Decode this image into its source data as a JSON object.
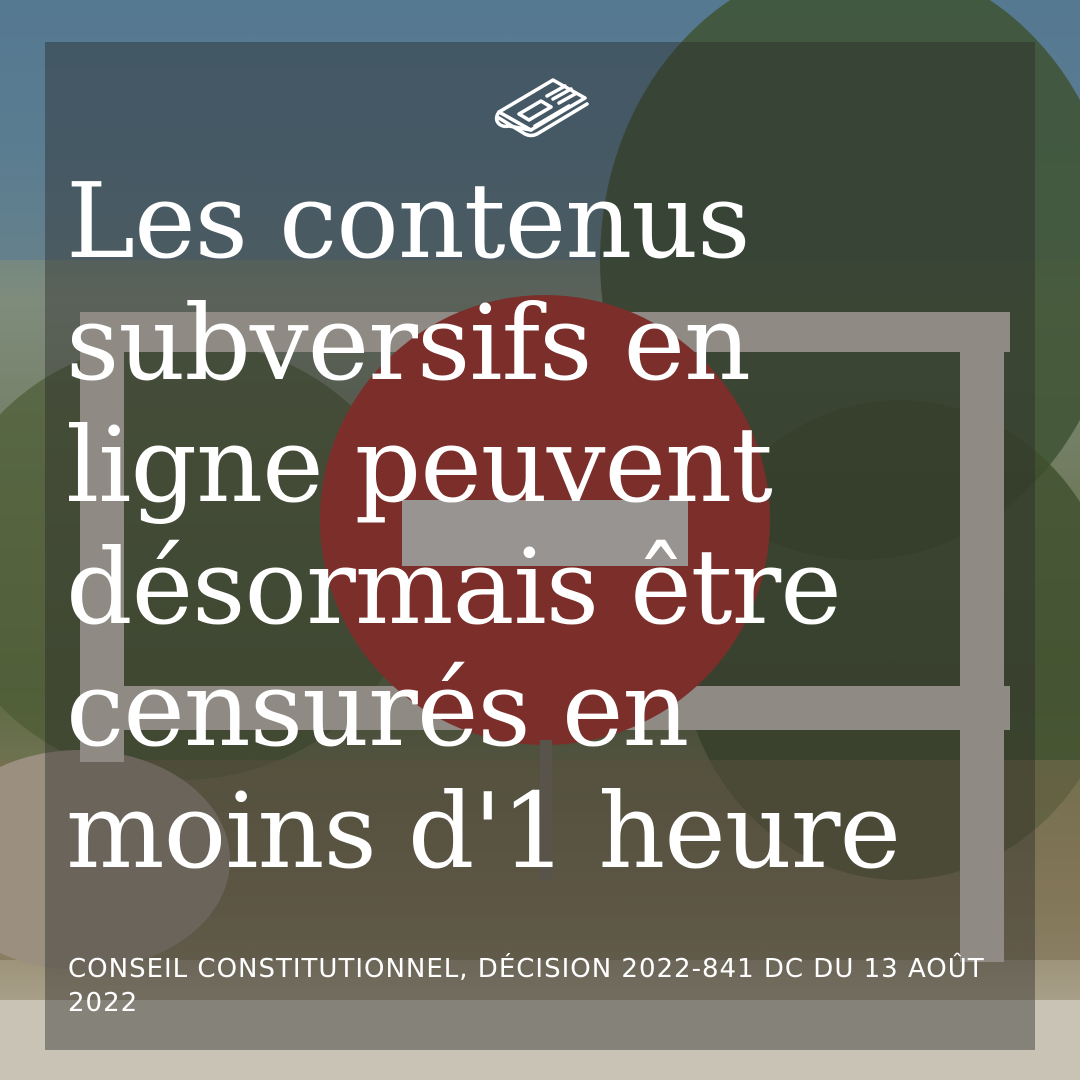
{
  "headline": {
    "lines": [
      "Les contenus",
      "subversifs en",
      "ligne peuvent",
      "désormais être",
      "censurés en",
      "moins d'1 heure"
    ]
  },
  "caption": "CONSEIL CONSTITUTIONNEL, DÉCISION 2022-841 DC DU 13 AOÛT 2022",
  "icons": {
    "header": "newspaper-icon"
  },
  "colors": {
    "text": "#ffffff",
    "overlay": "#282828",
    "sign_red": "#b8322b",
    "sign_bar": "#e8e2dc",
    "frame": "#d9d2c6"
  }
}
